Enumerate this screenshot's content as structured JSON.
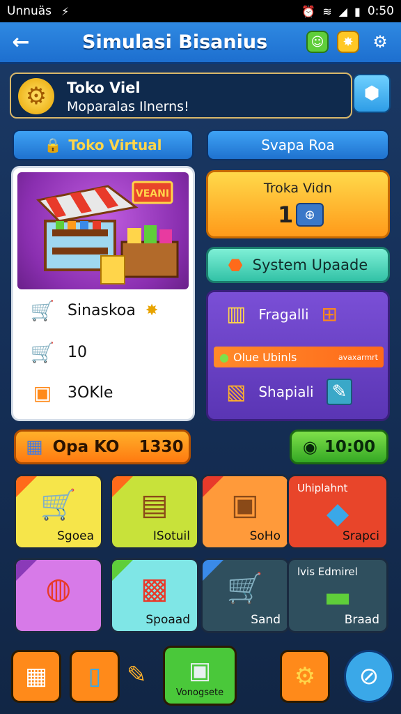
{
  "status_bar": {
    "carrier": "Unnuäs",
    "time": "0:50"
  },
  "app_bar": {
    "title": "Simulasi Bisanius"
  },
  "banner": {
    "title": "Toko Viel",
    "subtitle": "Moparalas Ilnerns!"
  },
  "tabs": {
    "active": "Toko Virtual",
    "inactive": "Svapa Roa"
  },
  "store_card": {
    "sign": "VEANI",
    "rows": [
      {
        "icon": "shopping-cart-icon",
        "label": "Sinaskoa"
      },
      {
        "icon": "shopping-cart-icon",
        "label": "10"
      },
      {
        "icon": "crate-icon",
        "label": "3OKle"
      }
    ]
  },
  "stats_panel": {
    "title": "Troka Vidn",
    "value": "1"
  },
  "upgrade_button": {
    "label": "System Upaade"
  },
  "purple_panel": {
    "row1_label": "Fragalli",
    "bar_left": "Olue Ubinls",
    "bar_right": "avaxarmrt",
    "row3_label": "Shapiali"
  },
  "orange_pill": {
    "label": "Opa KO",
    "value": "1330"
  },
  "green_pill": {
    "value": "10:00"
  },
  "tiles_row1": [
    {
      "label": "Sgoea",
      "bg": "#f6e54a"
    },
    {
      "label": "ISotuil",
      "bg": "#c8e23a"
    },
    {
      "label": "SoHo",
      "bg": "#ff9a3a"
    },
    {
      "toplabel": "Uhiplahnt",
      "label": "Srapci",
      "bg": "#e8452a"
    }
  ],
  "tiles_row2": [
    {
      "label": "",
      "bg": "#d77ae8"
    },
    {
      "label": "Spoaad",
      "bg": "#7fe6e6"
    },
    {
      "label": "Sand",
      "bg": "#2f4f5e"
    },
    {
      "toplabel": "lvis Edmirel",
      "label": "Braad",
      "bg": "#2f4f5e"
    }
  ],
  "dock": {
    "center_label": "Vonogsete"
  },
  "colors": {
    "primary": "#1d6fcf",
    "accent": "#ff9a1a",
    "positive": "#34a824"
  }
}
